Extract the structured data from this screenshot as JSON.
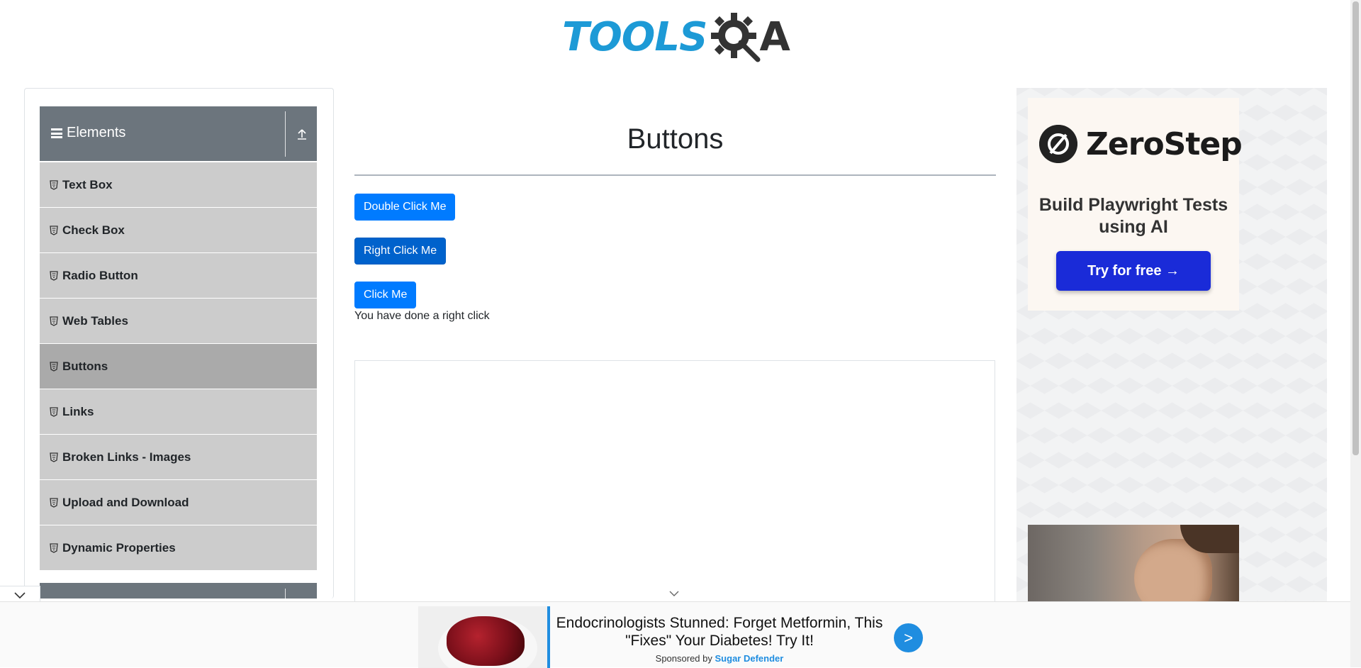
{
  "logo": {
    "text_blue": "TOOLS",
    "text_dark": "A",
    "icon": "gear-magnifier-icon",
    "blue": "#1d9ad6"
  },
  "sidebar": {
    "group_title": "Elements",
    "group_icon": "hamburger-icon",
    "toggle_icon": "collapse-up-icon",
    "active_index": 4,
    "items": [
      {
        "label": "Text Box"
      },
      {
        "label": "Check Box"
      },
      {
        "label": "Radio Button"
      },
      {
        "label": "Web Tables"
      },
      {
        "label": "Buttons"
      },
      {
        "label": "Links"
      },
      {
        "label": "Broken Links - Images"
      },
      {
        "label": "Upload and Download"
      },
      {
        "label": "Dynamic Properties"
      }
    ],
    "colors": {
      "header_bg": "#6c757d",
      "item_bg": "#cccccc",
      "active_bg": "#aaaaaa"
    }
  },
  "main": {
    "title": "Buttons",
    "double_click_label": "Double Click Me",
    "right_click_label": "Right Click Me",
    "click_label": "Click Me",
    "result_message": "You have done a right click",
    "button_color": "#007bff"
  },
  "right_ad": {
    "brand": "ZeroStep",
    "tagline": "Build Playwright Tests using AI",
    "cta": "Try for free →",
    "cta_color": "#1a2bd8"
  },
  "bottom_ad": {
    "headline": "Endocrinologists Stunned: Forget Metformin, This \"Fixes\" Your Diabetes! Try It!",
    "sponsored_prefix": "Sponsored by",
    "sponsor_name": "Sugar Defender",
    "arrow": ">",
    "accent": "#1f8de0"
  }
}
